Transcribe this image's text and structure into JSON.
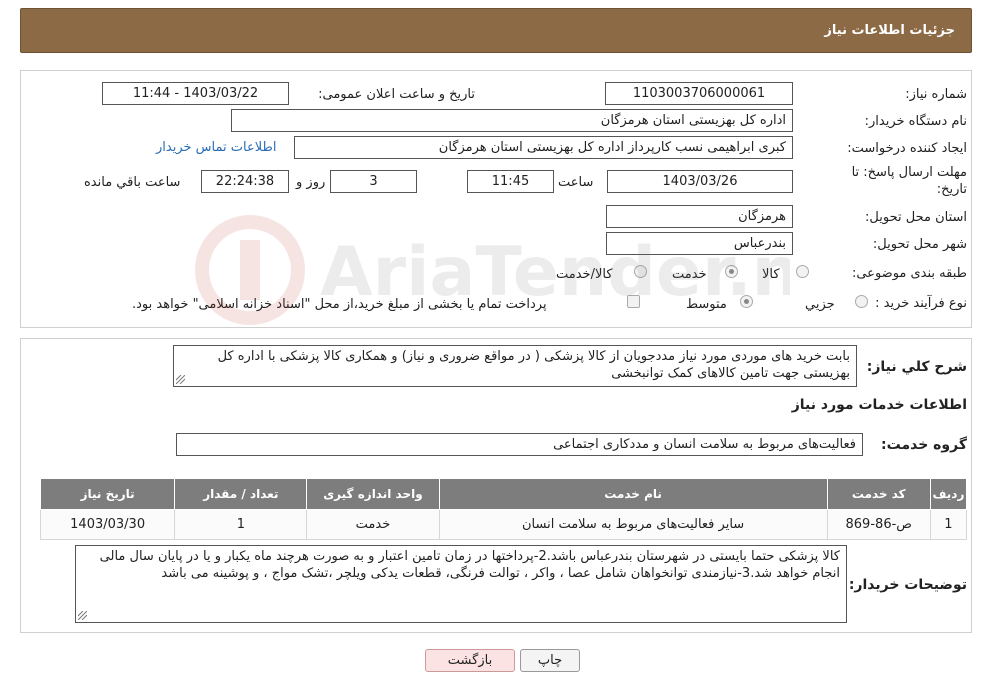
{
  "header": {
    "title": "جزئیات اطلاعات نیاز"
  },
  "need_info": {
    "need_number_label": "شماره نیاز:",
    "need_number": "1103003706000061",
    "announce_label": "تاریخ و ساعت اعلان عمومی:",
    "announce_value": "1403/03/22 - 11:44",
    "buyer_org_label": "نام دستگاه خریدار:",
    "buyer_org": "اداره کل بهزیستی استان هرمزگان",
    "creator_label": "ایجاد کننده درخواست:",
    "creator": "کبری  ابراهیمی نسب کارپرداز اداره کل بهزیستی استان هرمزگان",
    "contact_link": "اطلاعات تماس خریدار",
    "deadline_label_1": "مهلت ارسال پاسخ: تا",
    "deadline_label_2": "تاریخ:",
    "deadline_date": "1403/03/26",
    "time_label": "ساعت",
    "deadline_time": "11:45",
    "days_value": "3",
    "days_label": "روز و",
    "remaining_time": "22:24:38",
    "remaining_label": "ساعت باقي مانده",
    "province_label": "استان محل تحویل:",
    "province": "هرمزگان",
    "city_label": "شهر محل تحویل:",
    "city": "بندرعباس",
    "category_label": "طبقه بندی موضوعی:",
    "category_options": [
      "کالا",
      "خدمت",
      "کالا/خدمت"
    ],
    "category_selected": "خدمت",
    "process_label": "نوع فرآیند خرید :",
    "process_options": [
      "جزیي",
      "متوسط"
    ],
    "process_selected": "متوسط",
    "payment_note": "پرداخت تمام یا بخشی از مبلغ خرید،از محل \"اسناد خزانه اسلامی\" خواهد بود."
  },
  "description": {
    "label": "شرح کلي نياز:",
    "text": "بابت خرید های موردی مورد نیاز مددجویان از کالا پزشکی ( در مواقع ضروری و نیاز) و همکاری کالا پزشکی با اداره کل بهزیستی جهت تامین کالاهای کمک توانبخشی"
  },
  "services": {
    "section_title": "اطلاعات خدمات مورد نیاز",
    "group_label": "گروه خدمت:",
    "group_value": "فعالیت‌های مربوط به سلامت انسان و مددکاری اجتماعی",
    "table_headers": [
      "ردیف",
      "کد خدمت",
      "نام خدمت",
      "واحد اندازه گیری",
      "تعداد / مقدار",
      "تاریخ نیاز"
    ],
    "rows": [
      [
        "1",
        "ص-86-869",
        "سایر فعالیت‌های مربوط به سلامت انسان",
        "خدمت",
        "1",
        "1403/03/30"
      ]
    ]
  },
  "buyer_notes": {
    "label": "توضیحات خریدار:",
    "text": "کالا پزشکی حتما بایستی در شهرستان بندرعباس باشد.2-پرداختها در زمان تامین اعتبار و به صورت هرچند ماه یکبار و یا در پایان سال مالی انجام خواهد شد.3-نیازمندی توانخواهان شامل عصا ، واکر ، توالت فرنگی، قطعات یدکی ویلچر ،تشک مواج ، و پوشینه می باشد"
  },
  "buttons": {
    "print": "چاپ",
    "back": "بازگشت"
  },
  "colors": {
    "header_bg": "#8b6a45",
    "table_header_bg": "#7d7d7d",
    "link": "#2a6db5",
    "back_button_bg": "#fbe3e3"
  }
}
